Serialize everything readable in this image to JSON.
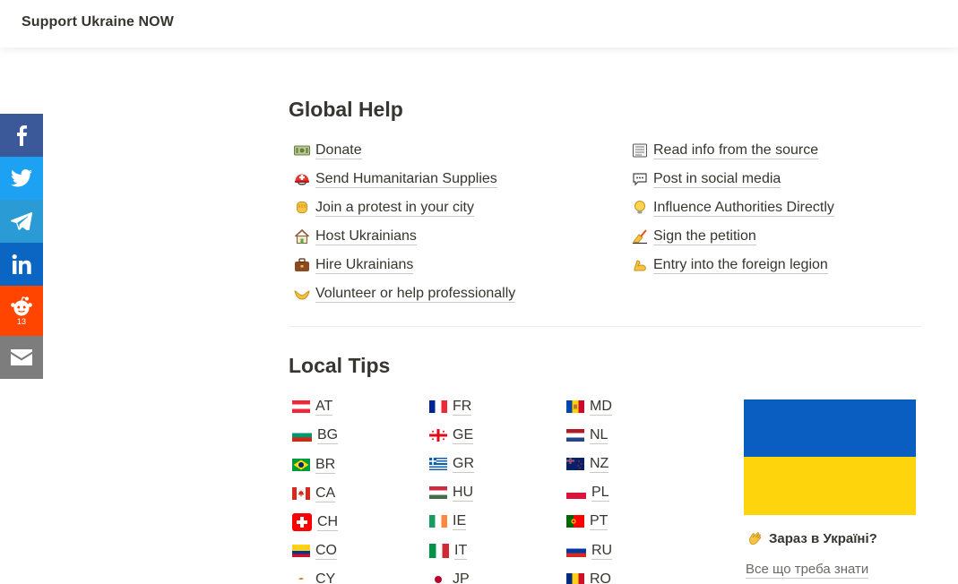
{
  "header": {
    "title": "Support Ukraine NOW"
  },
  "share": {
    "reddit_count": "13"
  },
  "global_help": {
    "title": "Global Help",
    "left": [
      {
        "icon": "money-icon",
        "label": "Donate"
      },
      {
        "icon": "rescue-helmet-icon",
        "label": "Send Humanitarian Supplies"
      },
      {
        "icon": "raised-fist-icon",
        "label": "Join a protest in your city"
      },
      {
        "icon": "house-icon",
        "label": "Host Ukrainians"
      },
      {
        "icon": "briefcase-icon",
        "label": "Hire Ukrainians"
      },
      {
        "icon": "open-hands-icon",
        "label": "Volunteer or help professionally"
      }
    ],
    "right": [
      {
        "icon": "newspaper-icon",
        "label": "Read info from the source"
      },
      {
        "icon": "speech-bubble-icon",
        "label": "Post in social media"
      },
      {
        "icon": "light-bulb-icon",
        "label": "Influence Authorities Directly"
      },
      {
        "icon": "writing-hand-icon",
        "label": "Sign the petition"
      },
      {
        "icon": "flexed-biceps-icon",
        "label": "Entry into the foreign legion"
      }
    ]
  },
  "local_tips": {
    "title": "Local Tips",
    "col1": [
      "AT",
      "BG",
      "BR",
      "CA",
      "CH",
      "CO",
      "CY"
    ],
    "col2": [
      "FR",
      "GE",
      "GR",
      "HU",
      "IE",
      "IT",
      "JP"
    ],
    "col3": [
      "MD",
      "NL",
      "NZ",
      "PL",
      "PT",
      "RU",
      "RO"
    ]
  },
  "card": {
    "title": "Зараз в Україні?",
    "link": "Все що треба знати"
  },
  "colors": {
    "ukraine_blue": "#0a5ec2",
    "ukraine_yellow": "#fed50d"
  }
}
